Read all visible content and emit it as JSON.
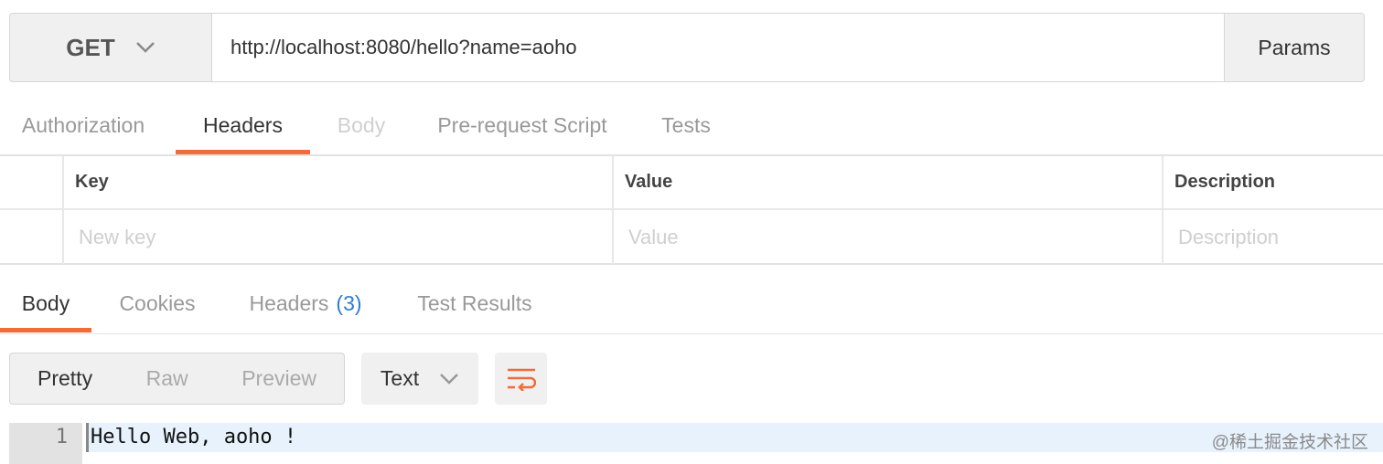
{
  "request": {
    "method": "GET",
    "url": "http://localhost:8080/hello?name=aoho",
    "params_label": "Params"
  },
  "request_tabs": [
    {
      "label": "Authorization",
      "state": "normal"
    },
    {
      "label": "Headers",
      "state": "active"
    },
    {
      "label": "Body",
      "state": "disabled"
    },
    {
      "label": "Pre-request Script",
      "state": "normal"
    },
    {
      "label": "Tests",
      "state": "normal"
    }
  ],
  "headers_table": {
    "columns": [
      "Key",
      "Value",
      "Description"
    ],
    "new_row_placeholders": {
      "key": "New key",
      "value": "Value",
      "description": "Description"
    }
  },
  "response_tabs": [
    {
      "label": "Body",
      "state": "active"
    },
    {
      "label": "Cookies",
      "state": "normal"
    },
    {
      "label": "Headers",
      "count": "(3)",
      "state": "normal"
    },
    {
      "label": "Test Results",
      "state": "normal"
    }
  ],
  "response_view": {
    "modes": [
      "Pretty",
      "Raw",
      "Preview"
    ],
    "active_mode": "Pretty",
    "format": "Text",
    "wrap_icon": "wrap-lines-icon"
  },
  "response_body": {
    "line_number": "1",
    "text": "Hello Web, aoho !"
  },
  "watermark": "@稀土掘金技术社区",
  "colors": {
    "accent": "#f26b3a",
    "count_blue": "#2e7cd6",
    "highlight_line": "#e8f2fd"
  }
}
